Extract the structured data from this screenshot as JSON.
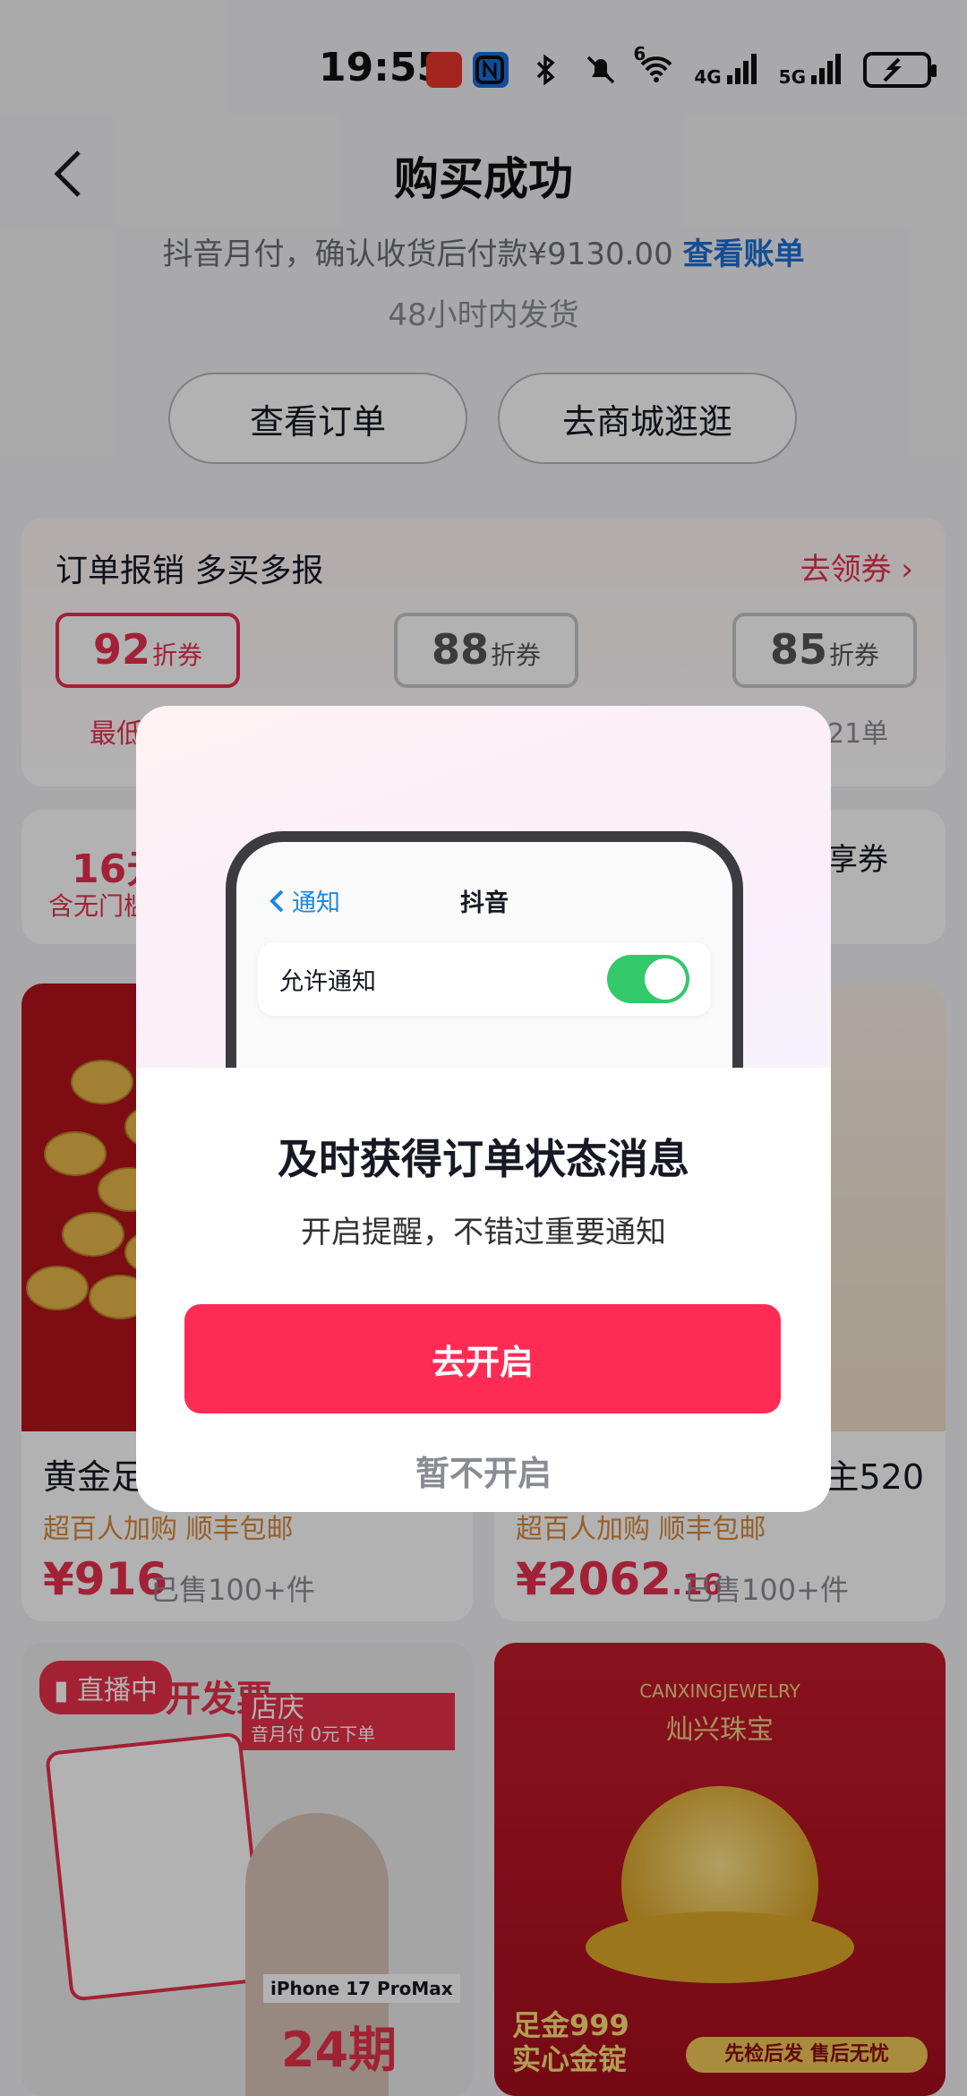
{
  "status_bar": {
    "time": "19:55",
    "signal_4g": "4G",
    "signal_5g": "5G",
    "wifi_badge": "6"
  },
  "header": {
    "title": "购买成功",
    "pay_info": "抖音月付，确认收货后付款¥9130.00",
    "pay_link": "查看账单",
    "ship_info": "48小时内发货",
    "buttons": [
      "查看订单",
      "去商城逛逛"
    ]
  },
  "coupon_card": {
    "title": "订单报销 多买多报",
    "link": "去领券",
    "coupons": [
      {
        "num": "92",
        "unit": "折券"
      },
      {
        "num": "88",
        "unit": "折券"
      },
      {
        "num": "85",
        "unit": "折券"
      }
    ],
    "left_note": "最低",
    "right_note": "21单"
  },
  "voucher": {
    "amount": "16元",
    "desc": "含无门槛",
    "right_text": "享券"
  },
  "products": [
    {
      "name": "黄金足",
      "tags": "超百人加购   顺丰包邮",
      "price": "¥916",
      "price_dec": "",
      "sold": "已售100+件"
    },
    {
      "name": "主520",
      "tags": "超百人加购   顺丰包邮",
      "price": "¥2062",
      "price_dec": ".16",
      "sold": "已售100+件"
    }
  ],
  "bottom_cards": {
    "live_badge": "直播中",
    "live_banner": "店庆",
    "live_banner_sub": "音月付 0元下单",
    "invoice": "开发票",
    "iphone_label": "iPhone 17 ProMax",
    "installment": "24期",
    "jewelry_brand_en": "CANXINGJEWELRY",
    "jewelry_brand": "灿兴珠宝",
    "jewelry_promo": "足金999\n实心金锭",
    "jewelry_service": "先检后发  售后无忧"
  },
  "dialog": {
    "phone_back": "通知",
    "phone_title": "抖音",
    "phone_row_label": "允许通知",
    "title": "及时获得订单状态消息",
    "subtitle": "开启提醒，不错过重要通知",
    "primary": "去开启",
    "secondary": "暂不开启"
  },
  "colors": {
    "accent": "#fe2c55",
    "link": "#1c6fd4",
    "toggle": "#33c86a"
  }
}
